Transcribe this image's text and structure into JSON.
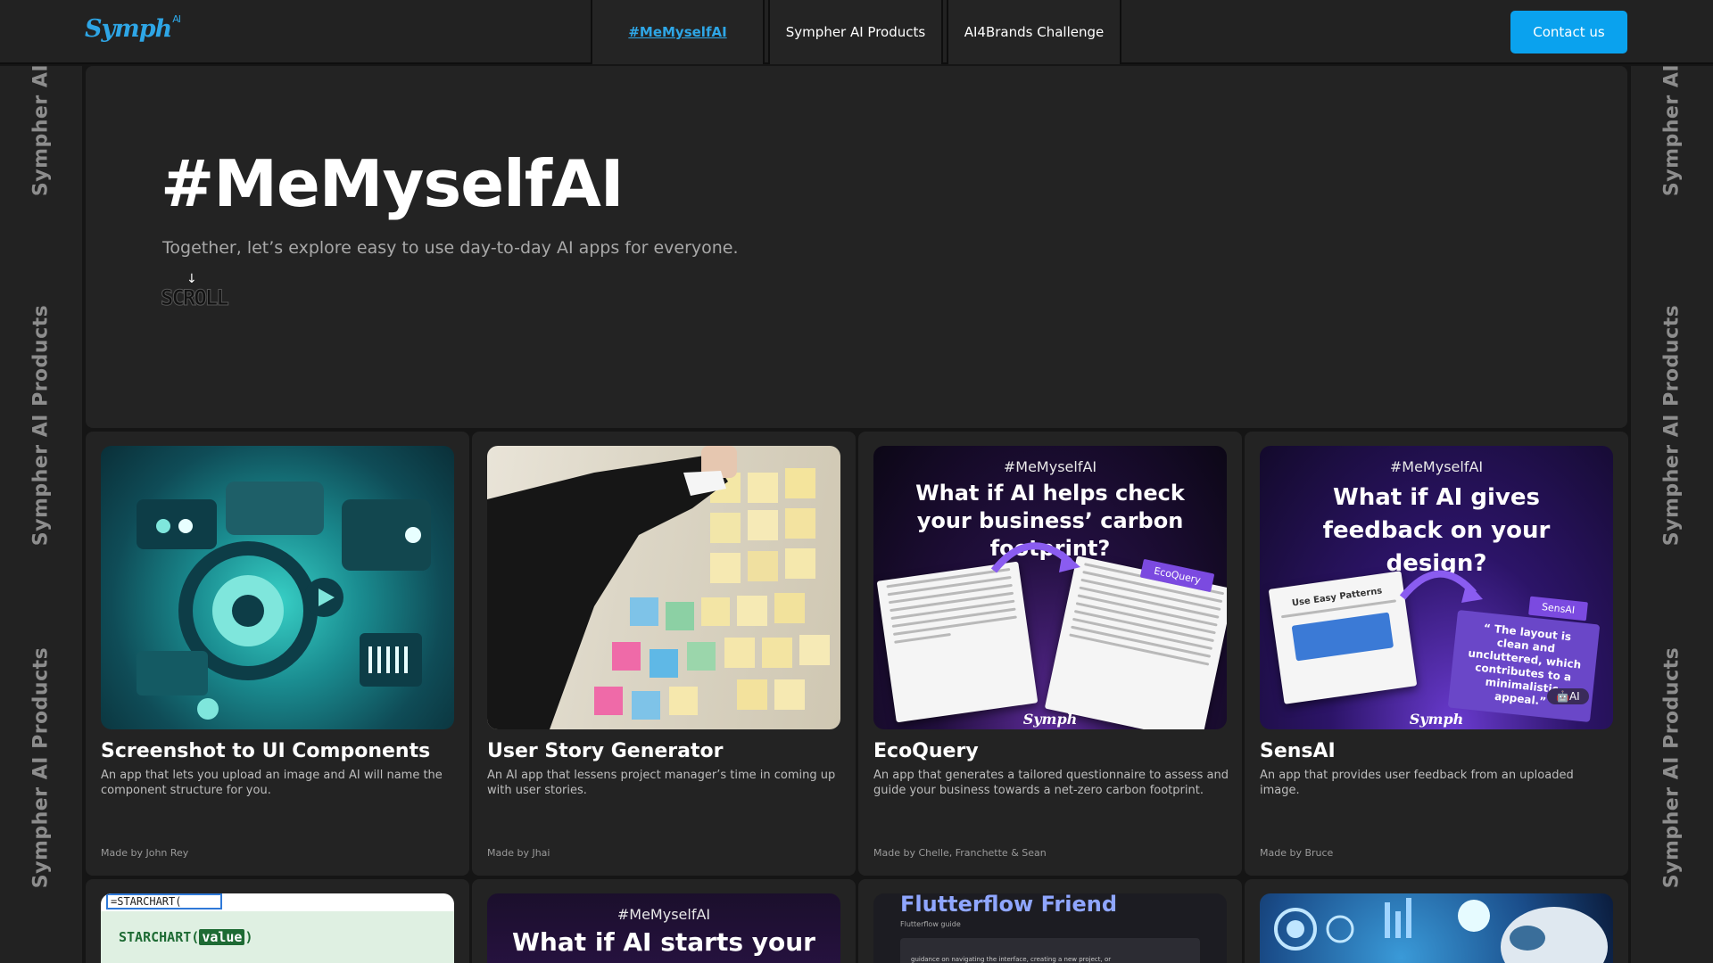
{
  "brand": {
    "logo_text": "Symph",
    "logo_super": "AI"
  },
  "nav": {
    "items": [
      {
        "label": "#MeMyselfAI",
        "active": true
      },
      {
        "label": "Sympher AI Products",
        "active": false
      },
      {
        "label": "AI4Brands Challenge",
        "active": false
      }
    ],
    "contact_label": "Contact us"
  },
  "rails": {
    "labels": [
      "Sympher AI",
      "Sympher AI Products",
      "Sympher AI Products"
    ]
  },
  "hero": {
    "title": "#MeMyselfAI",
    "subtitle": "Together, let’s explore  easy to use day-to-day AI apps for everyone.",
    "scroll_label": "SCROLL",
    "scroll_arrow": "↓"
  },
  "cards": [
    {
      "title": "Screenshot to UI Components",
      "description": "An app that lets you upload an image and AI will name the component structure for you.",
      "made_by": "Made by  John Rey"
    },
    {
      "title": "User Story Generator",
      "description": "An AI app that lessens project manager’s time in coming up with user stories.",
      "made_by": "Made by  Jhai"
    },
    {
      "title": "EcoQuery",
      "description": "An app that generates a tailored questionnaire to assess and guide your business towards a net-zero carbon footprint.",
      "made_by": "Made by  Chelle, Franchette & Sean",
      "thumb_tag": "#MeMyselfAI",
      "thumb_headline": "What if AI helps check your business’ carbon footprint?",
      "thumb_pill": "EcoQuery",
      "thumb_footer": "Symph"
    },
    {
      "title": "SensAI",
      "description": "An app that provides user feedback from an uploaded image.",
      "made_by": "Made by  Bruce",
      "thumb_tag": "#MeMyselfAI",
      "thumb_headline": "What if AI gives feedback on your design?",
      "thumb_pill": "SensAI",
      "thumb_doc_title": "Use Easy Patterns",
      "thumb_quote": "“ The layout is clean and uncluttered, which contributes to a minimalistic appeal.”",
      "thumb_badge": "AI",
      "thumb_footer": "Symph"
    }
  ],
  "cards_row2": [
    {
      "thumb_formula": "=STARCHART(",
      "thumb_function": "STARCHART(",
      "thumb_value": "value",
      "thumb_close": ")"
    },
    {
      "thumb_tag": "#MeMyselfAI",
      "thumb_headline": "What if AI starts your"
    },
    {
      "thumb_title": "Flutterflow Friend",
      "thumb_sub": "Flutterflow guide",
      "thumb_text": "guidance on navigating the interface, creating a new project, or"
    },
    {}
  ],
  "colors": {
    "accent": "#0aa2ee",
    "link_active": "#2ea6e6",
    "background": "#151515",
    "panel": "#232323"
  }
}
